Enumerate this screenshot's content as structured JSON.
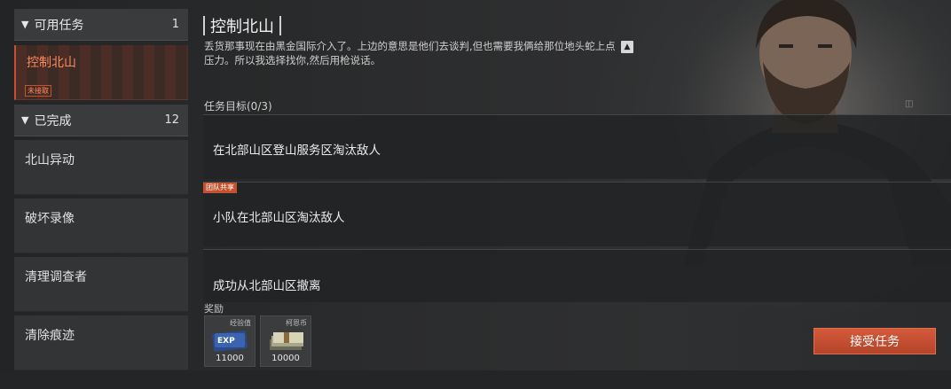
{
  "sidebar": {
    "available": {
      "label": "可用任务",
      "count": "1"
    },
    "active_task": {
      "name": "控制北山",
      "status_tag": "未接取"
    },
    "completed": {
      "label": "已完成",
      "count": "12"
    },
    "completed_items": [
      "北山异动",
      "破坏录像",
      "清理调查者",
      "清除痕迹"
    ]
  },
  "mission": {
    "title": "控制北山",
    "description": "丢货那事现在由黑金国际介入了。上边的意思是他们去谈判,但也需要我俩给那位地头蛇上点压力。所以我选择找你,然后用枪说话。",
    "objectives_title": "任务目标(0/3)",
    "objectives": [
      {
        "text": "在北部山区登山服务区淘汰敌人",
        "tag": ""
      },
      {
        "text": "小队在北部山区淘汰敌人",
        "tag": "团队共享"
      },
      {
        "text": "成功从北部山区撤离",
        "tag": ""
      }
    ]
  },
  "rewards": {
    "label": "奖励",
    "items": [
      {
        "name": "经验值",
        "value": "11000",
        "icon": "exp-card-icon"
      },
      {
        "name": "柯恩币",
        "value": "10000",
        "icon": "cash-stack-icon"
      }
    ]
  },
  "accept_button": "接受任务",
  "colors": {
    "accent": "#c5512f",
    "accent_text": "#ff8a5a"
  }
}
